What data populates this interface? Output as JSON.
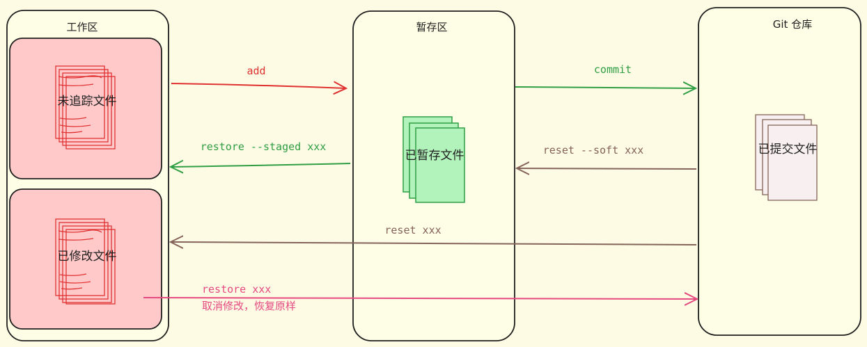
{
  "zones": {
    "workspace": {
      "title": "工作区"
    },
    "staging": {
      "title": "暂存区"
    },
    "repo": {
      "title": "Git 仓库"
    }
  },
  "boxes": {
    "untracked": {
      "label": "未追踪文件",
      "color": "#e03131"
    },
    "modified": {
      "label": "已修改文件",
      "color": "#e03131"
    },
    "staged": {
      "label": "已暂存文件",
      "color": "#2f9e44",
      "fill": "#b2f2bb"
    },
    "committed": {
      "label": "已提交文件",
      "color": "#846358",
      "fill": "#f8f0f0"
    }
  },
  "edges": {
    "add": {
      "label": "add",
      "color": "#e03131"
    },
    "commit": {
      "label": "commit",
      "color": "#2f9e44"
    },
    "restore_staged": {
      "label": "restore --staged xxx",
      "color": "#2f9e44"
    },
    "reset_soft": {
      "label": "reset --soft xxx",
      "color": "#846358"
    },
    "reset": {
      "label": "reset xxx",
      "color": "#846358"
    },
    "restore": {
      "label": "restore xxx",
      "sublabel": "取消修改，恢复原样",
      "color": "#e64980"
    }
  }
}
